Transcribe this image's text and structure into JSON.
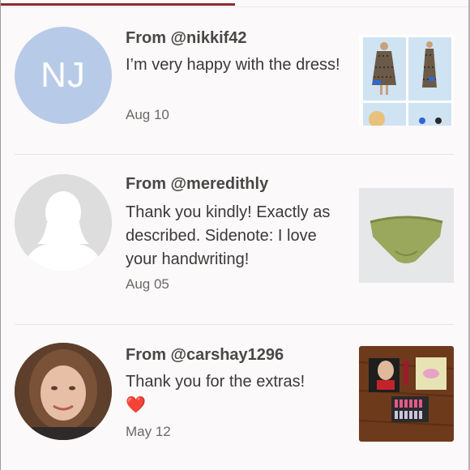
{
  "reviews": [
    {
      "avatar_initials": "NJ",
      "from": "From @nikkif42",
      "message": "I’m very happy with the dress!",
      "date": "Aug 10",
      "thumbnail_icon": "dress-photo-collage"
    },
    {
      "avatar_icon": "person-silhouette-icon",
      "from": "From @meredithly",
      "message": "Thank you kindly! Exactly as described. Sidenote: I love your handwriting!",
      "date": "Aug 05",
      "thumbnail_icon": "green-underwear-photo"
    },
    {
      "avatar_icon": "user-photo",
      "from": "From @carshay1296",
      "message": "Thank you for the extras!",
      "emoji": "❤️",
      "date": "May 12",
      "thumbnail_icon": "makeup-items-photo"
    }
  ],
  "colors": {
    "accent": "#8c2b30",
    "avatar_blue": "#b7cbe8",
    "heart": "#e0242c"
  }
}
